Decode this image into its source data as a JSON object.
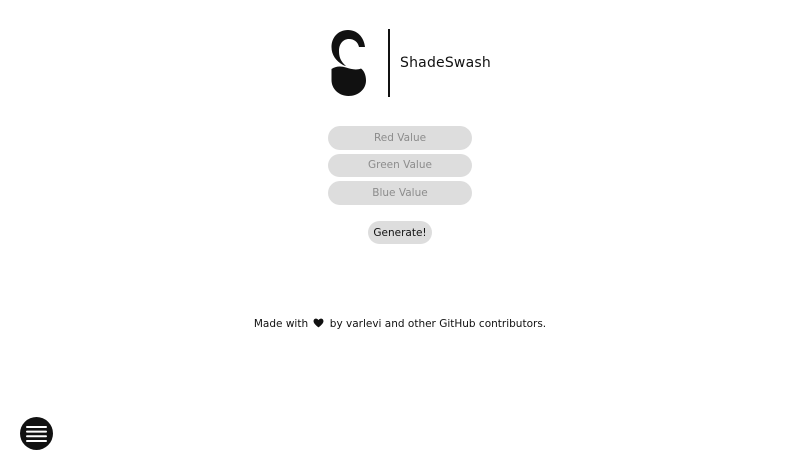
{
  "brand": {
    "name": "ShadeSwash",
    "logo_icon": "s-logo-icon"
  },
  "inputs": {
    "red_placeholder": "Red Value",
    "green_placeholder": "Green Value",
    "blue_placeholder": "Blue Value"
  },
  "actions": {
    "generate_label": "Generate!"
  },
  "footer": {
    "credit_before": "Made with",
    "heart_icon": "heart-icon",
    "credit_after": "by varlevi and other GitHub contributors."
  },
  "menu": {
    "icon": "hamburger-menu-icon"
  },
  "colors": {
    "background": "#ffffff",
    "text": "#111111",
    "field": "#dddddd",
    "placeholder": "#8c8c8c"
  }
}
